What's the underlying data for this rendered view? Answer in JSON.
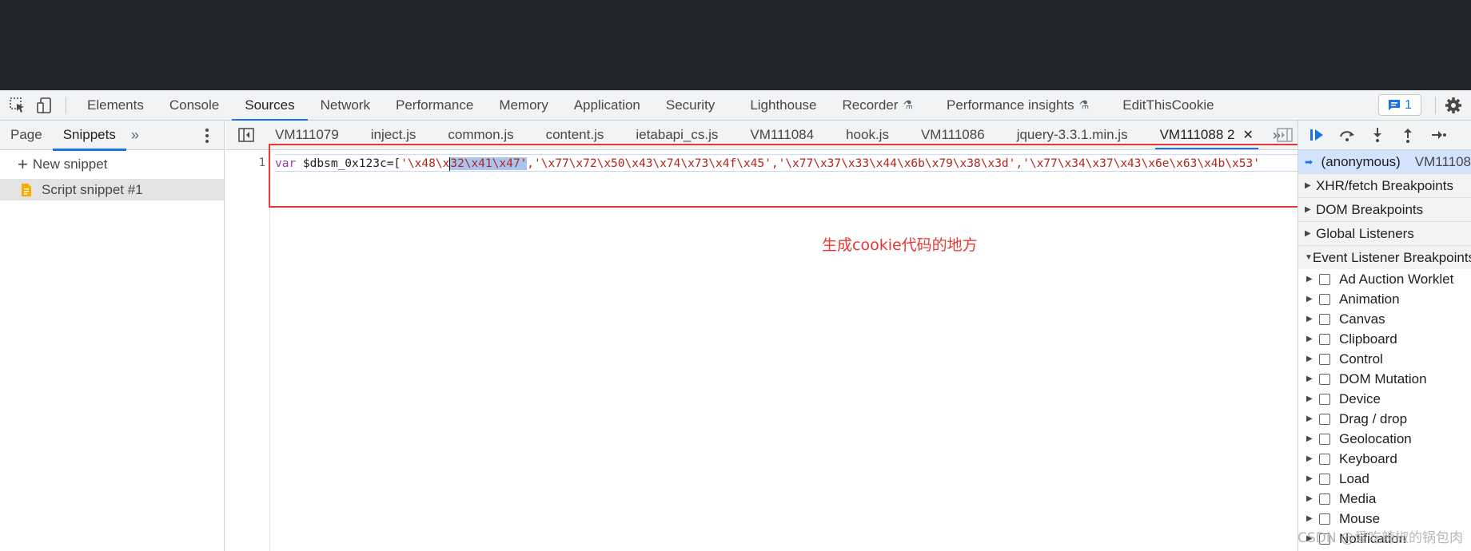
{
  "main_tabs": [
    "Elements",
    "Console",
    "Sources",
    "Network",
    "Performance",
    "Memory",
    "Application",
    "Security",
    "Lighthouse",
    "Recorder",
    "Performance insights",
    "EditThisCookie"
  ],
  "issues_count": "1",
  "navigator": {
    "tabs": [
      "Page",
      "Snippets"
    ],
    "new_snippet": "New snippet",
    "snippet": "Script snippet #1"
  },
  "editor": {
    "file_tabs": [
      "VM111079",
      "inject.js",
      "common.js",
      "content.js",
      "ietabapi_cs.js",
      "VM111084",
      "hook.js",
      "VM111086",
      "jquery-3.3.1.min.js",
      "VM111088 2"
    ],
    "line_number": "1",
    "code": {
      "keyword": "var",
      "identifier": " $dbsm_0x123c=[",
      "str1_a": "'\\x48\\x",
      "str1_b": "32\\x41\\x47'",
      "rest": ",'\\x77\\x72\\x50\\x43\\x74\\x73\\x4f\\x45','\\x77\\x37\\x33\\x44\\x6b\\x79\\x38\\x3d','\\x77\\x34\\x37\\x43\\x6e\\x63\\x4b\\x53'"
    },
    "annotation": "生成cookie代码的地方"
  },
  "debugger": {
    "call_frame": {
      "name": "(anonymous)",
      "location": "VM11108"
    },
    "sections": [
      "XHR/fetch Breakpoints",
      "DOM Breakpoints",
      "Global Listeners",
      "Event Listener Breakpoints"
    ],
    "event_listener_items": [
      "Ad Auction Worklet",
      "Animation",
      "Canvas",
      "Clipboard",
      "Control",
      "DOM Mutation",
      "Device",
      "Drag / drop",
      "Geolocation",
      "Keyboard",
      "Load",
      "Media",
      "Mouse",
      "Notification"
    ]
  },
  "watermark": "CSDN @爱吃辣椒的锅包肉",
  "colors": {
    "accent": "#1a73e8",
    "annotation": "#e53935",
    "top_bar": "#23252e"
  }
}
